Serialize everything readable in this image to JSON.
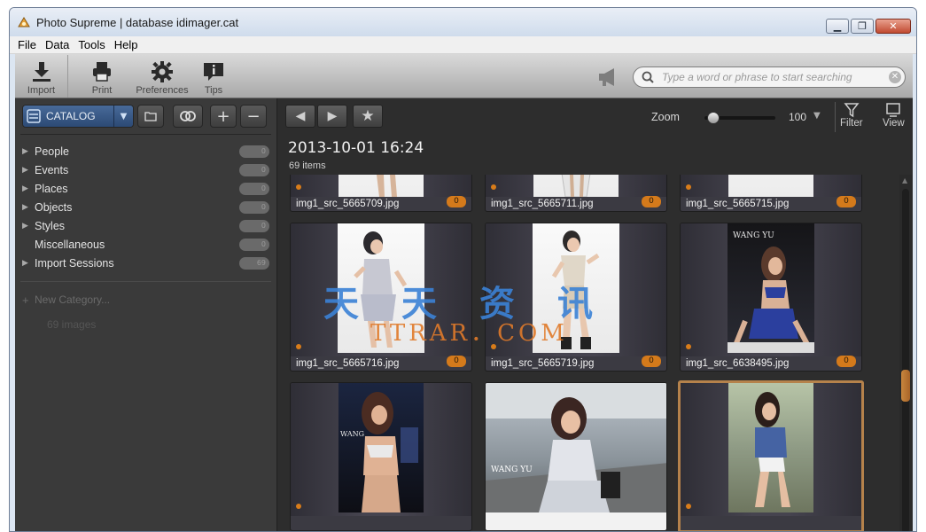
{
  "window": {
    "title": "Photo Supreme | database idimager.cat",
    "min": "▁",
    "max": "❐",
    "close": "✕"
  },
  "menu": [
    "File",
    "Data",
    "Tools",
    "Help"
  ],
  "toolbar": {
    "import": "Import",
    "print": "Print",
    "preferences": "Preferences",
    "tips": "Tips"
  },
  "search": {
    "placeholder": "Type a word or phrase to start searching"
  },
  "sidebar": {
    "catalog_label": "CATALOG",
    "items": [
      {
        "label": "People",
        "count": "0",
        "expandable": true
      },
      {
        "label": "Events",
        "count": "0",
        "expandable": true
      },
      {
        "label": "Places",
        "count": "0",
        "expandable": true
      },
      {
        "label": "Objects",
        "count": "0",
        "expandable": true
      },
      {
        "label": "Styles",
        "count": "0",
        "expandable": true
      },
      {
        "label": "Miscellaneous",
        "count": "0",
        "expandable": false
      },
      {
        "label": "Import Sessions",
        "count": "69",
        "expandable": true
      }
    ],
    "new_category": "New Category...",
    "images_count": "69 images"
  },
  "main": {
    "zoom_label": "Zoom",
    "zoom_value": "100",
    "zoom_level": 0.05,
    "filter_label": "Filter",
    "view_label": "View",
    "date_title": "2013-10-01 16:24",
    "item_count": "69 items",
    "thumbnails": [
      {
        "file": "img1_src_5665709.jpg",
        "badge": "0"
      },
      {
        "file": "img1_src_5665711.jpg",
        "badge": "0"
      },
      {
        "file": "img1_src_5665715.jpg",
        "badge": "0"
      },
      {
        "file": "img1_src_5665716.jpg",
        "badge": "0"
      },
      {
        "file": "img1_src_5665719.jpg",
        "badge": "0"
      },
      {
        "file": "img1_src_6638495.jpg",
        "badge": "0"
      },
      {
        "file": "",
        "badge": ""
      },
      {
        "file": "",
        "badge": ""
      },
      {
        "file": "",
        "badge": ""
      }
    ],
    "photo_text": {
      "wang_yu_1": "WANG YU",
      "wang_yu_2": "WANG",
      "wang_yu_3": "WANG YU"
    }
  },
  "watermark": {
    "cn": "天天资讯",
    "en": "TTRAR．COM"
  },
  "colors": {
    "accent_orange": "#d47a1b",
    "catalog_blue": "#3a5a88",
    "selected_border": "#b5824b"
  }
}
